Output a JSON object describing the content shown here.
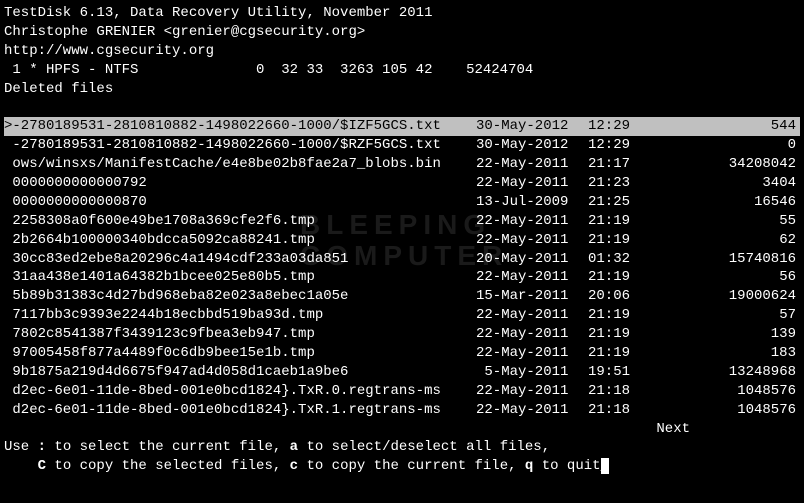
{
  "header": {
    "title": "TestDisk 6.13, Data Recovery Utility, November 2011",
    "author": "Christophe GRENIER <grenier@cgsecurity.org>",
    "url": "http://www.cgsecurity.org",
    "partition": " 1 * HPFS - NTFS              0  32 33  3263 105 42    52424704",
    "mode": "Deleted files"
  },
  "files": [
    {
      "selected": true,
      "name": ">-2780189531-2810810882-1498022660-1000/$IZF5GCS.txt",
      "date": "30-May-2012",
      "time": "12:29",
      "size": "544"
    },
    {
      "selected": false,
      "name": " -2780189531-2810810882-1498022660-1000/$RZF5GCS.txt",
      "date": "30-May-2012",
      "time": "12:29",
      "size": "0"
    },
    {
      "selected": false,
      "name": " ows/winsxs/ManifestCache/e4e8be02b8fae2a7_blobs.bin",
      "date": "22-May-2011",
      "time": "21:17",
      "size": "34208042"
    },
    {
      "selected": false,
      "name": " 0000000000000792",
      "date": "22-May-2011",
      "time": "21:23",
      "size": "3404"
    },
    {
      "selected": false,
      "name": " 0000000000000870",
      "date": "13-Jul-2009",
      "time": "21:25",
      "size": "16546"
    },
    {
      "selected": false,
      "name": " 2258308a0f600e49be1708a369cfe2f6.tmp",
      "date": "22-May-2011",
      "time": "21:19",
      "size": "55"
    },
    {
      "selected": false,
      "name": " 2b2664b100000340bdcca5092ca88241.tmp",
      "date": "22-May-2011",
      "time": "21:19",
      "size": "62"
    },
    {
      "selected": false,
      "name": " 30cc83ed2ebe8a20296c4a1494cdf233a03da851",
      "date": "20-May-2011",
      "time": "01:32",
      "size": "15740816"
    },
    {
      "selected": false,
      "name": " 31aa438e1401a64382b1bcee025e80b5.tmp",
      "date": "22-May-2011",
      "time": "21:19",
      "size": "56"
    },
    {
      "selected": false,
      "name": " 5b89b31383c4d27bd968eba82e023a8ebec1a05e",
      "date": "15-Mar-2011",
      "time": "20:06",
      "size": "19000624"
    },
    {
      "selected": false,
      "name": " 7117bb3c9393e2244b18ecbbd519ba93d.tmp",
      "date": "22-May-2011",
      "time": "21:19",
      "size": "57"
    },
    {
      "selected": false,
      "name": " 7802c8541387f3439123c9fbea3eb947.tmp",
      "date": "22-May-2011",
      "time": "21:19",
      "size": "139"
    },
    {
      "selected": false,
      "name": " 97005458f877a4489f0c6db9bee15e1b.tmp",
      "date": "22-May-2011",
      "time": "21:19",
      "size": "183"
    },
    {
      "selected": false,
      "name": " 9b1875a219d4d6675f947ad4d058d1caeb1a9be6",
      "date": "5-May-2011",
      "time": "19:51",
      "size": "13248968"
    },
    {
      "selected": false,
      "name": " d2ec-6e01-11de-8bed-001e0bcd1824}.TxR.0.regtrans-ms",
      "date": "22-May-2011",
      "time": "21:18",
      "size": "1048576"
    },
    {
      "selected": false,
      "name": " d2ec-6e01-11de-8bed-001e0bcd1824}.TxR.1.regtrans-ms",
      "date": "22-May-2011",
      "time": "21:18",
      "size": "1048576"
    }
  ],
  "footer": {
    "next": "Next",
    "help1_a": "Use ",
    "help1_b": ":",
    "help1_c": " to select the current file, ",
    "help1_d": "a",
    "help1_e": " to select/deselect all files,",
    "help2_a": "    ",
    "help2_b": "C",
    "help2_c": " to copy the selected files, ",
    "help2_d": "c",
    "help2_e": " to copy the current file, ",
    "help2_f": "q",
    "help2_g": " to quit"
  },
  "watermark": {
    "line1": "BLEEPING",
    "line2": "COMPUTER"
  }
}
